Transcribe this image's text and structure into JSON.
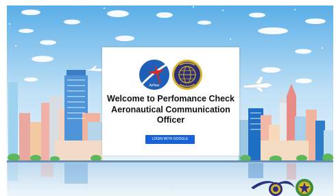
{
  "welcome": {
    "line1": "Welcome to Perfomance Check",
    "line2": "Aeronautical Communication",
    "line3": "Officer"
  },
  "login": {
    "label": "LOGIN WITH GOOGLE"
  },
  "logos": {
    "left": {
      "icon": "airnav-logo",
      "text": "AirNav"
    },
    "right": {
      "icon": "aviation-globe-emblem"
    }
  },
  "footer_emblems": [
    {
      "icon": "winged-emblem"
    },
    {
      "icon": "star-wreath-emblem"
    }
  ],
  "colors": {
    "sky": "#d7ecfa",
    "button": "#1a63d6",
    "airnav_blue": "#1f5fb8",
    "airnav_red": "#d32a2a",
    "emblem_navy": "#2c2f7a",
    "emblem_gold": "#d9b12b",
    "water": "#cfe4f4"
  }
}
